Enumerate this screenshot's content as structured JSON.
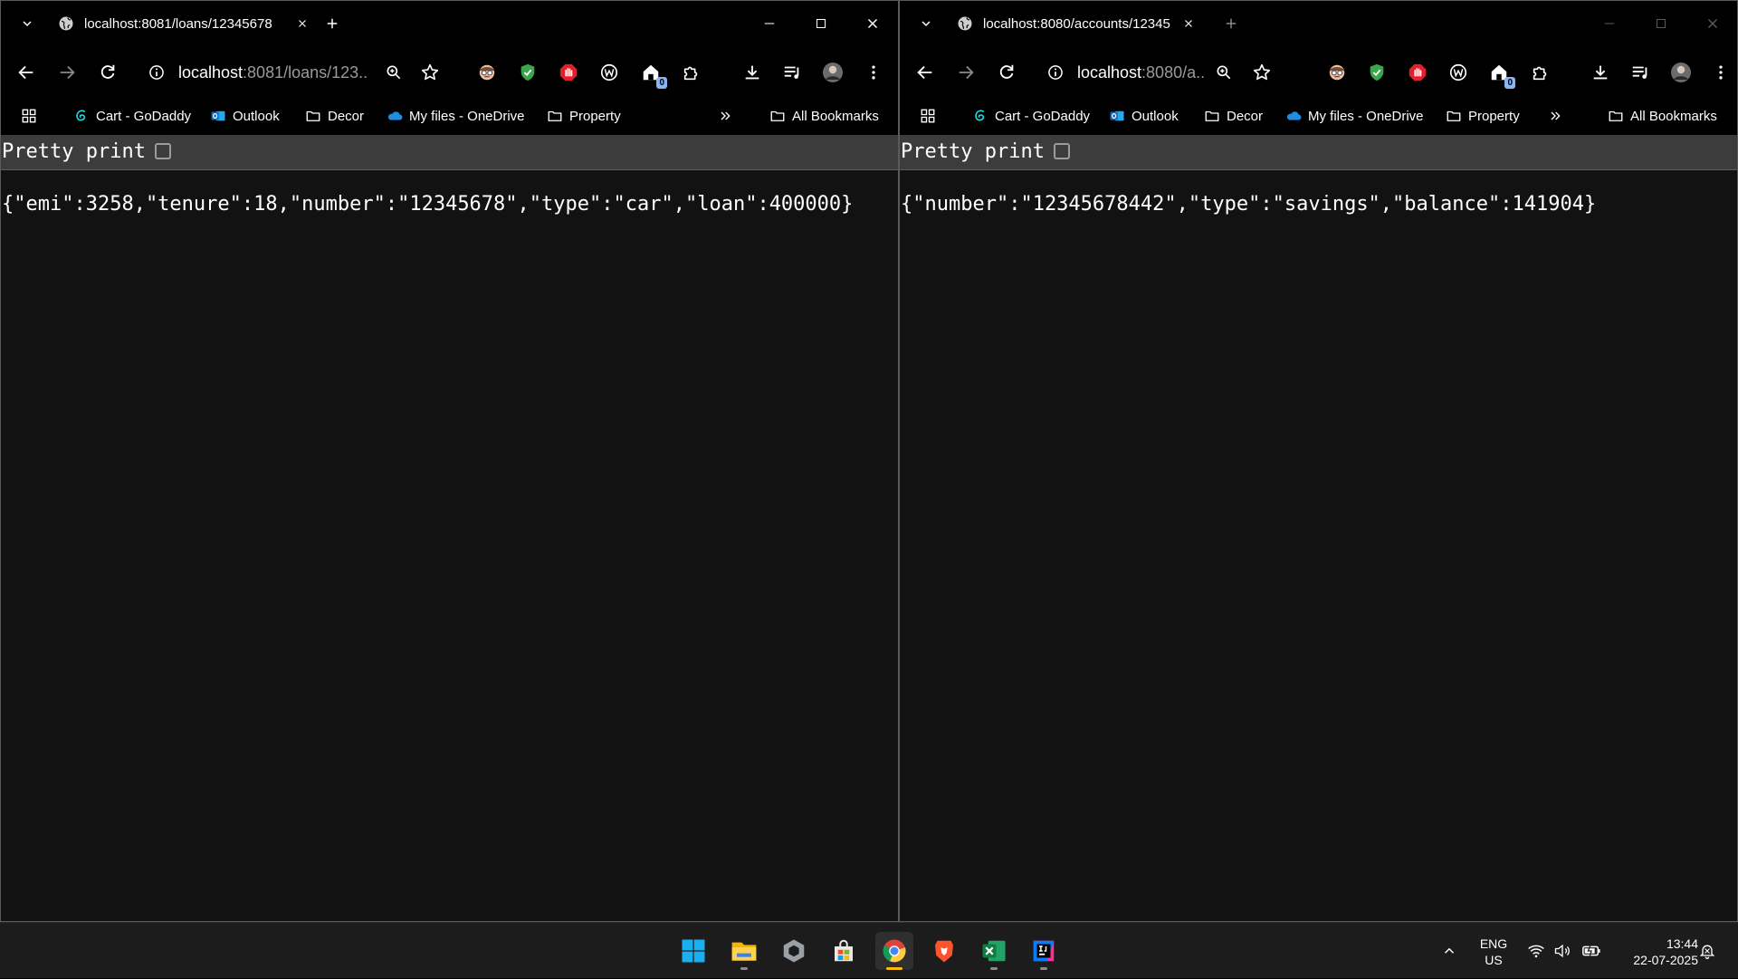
{
  "left_window": {
    "tab_title": "localhost:8081/loans/12345678",
    "url_host": "localhost",
    "url_path": ":8081/loans/123...",
    "pretty_print_label": "Pretty print",
    "json_text": "{\"emi\":3258,\"tenure\":18,\"number\":\"12345678\",\"type\":\"car\",\"loan\":400000}"
  },
  "right_window": {
    "tab_title": "localhost:8080/accounts/12345",
    "url_host": "localhost",
    "url_path": ":8080/a...",
    "pretty_print_label": "Pretty print",
    "json_text": "{\"number\":\"12345678442\",\"type\":\"savings\",\"balance\":141904}"
  },
  "bookmarks": {
    "items": [
      "Cart - GoDaddy",
      "Outlook",
      "Decor",
      "My files - OneDrive",
      "Property"
    ],
    "all_bookmarks": "All Bookmarks"
  },
  "extensions": {
    "badge_count": "0"
  },
  "taskbar": {
    "apps": [
      "start-menu",
      "file-explorer",
      "app-icon",
      "microsoft-store",
      "chrome",
      "brave",
      "excel",
      "intellij"
    ],
    "active_app": "chrome",
    "lang_primary": "ENG",
    "lang_secondary": "US",
    "time": "13:44",
    "date": "22-07-2025"
  },
  "colors": {
    "page_bg": "#121212",
    "chrome_bg": "#000000",
    "pretty_print_bar": "#3c3c3c",
    "taskbar_bg": "#1c1c1c",
    "active_indicator": "#fbbc04"
  }
}
